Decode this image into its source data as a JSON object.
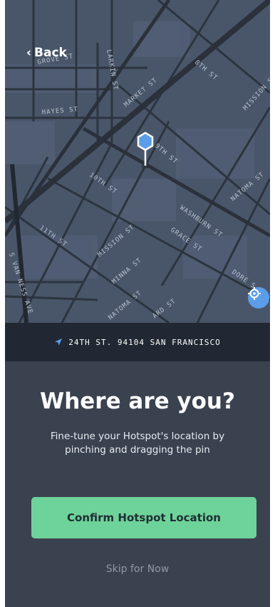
{
  "nav": {
    "back_label": "Back",
    "back_icon": "chevron-left-icon"
  },
  "map": {
    "streets": {
      "grove": "GROVE ST",
      "larkin": "LARKIN ST",
      "eighth": "8TH ST",
      "market": "MARKET ST",
      "mission_top": "MISSION S",
      "hayes": "HAYES ST",
      "ninth": "9TH ST",
      "tenth": "10TH ST",
      "natoma_right": "NATOMA ST",
      "washburn": "WASHBURN ST",
      "eleventh": "11TH ST",
      "mission_mid": "MISSION ST",
      "grace": "GRACE ST",
      "van_ness": "S VAN NESS AVE",
      "minna": "MINNA ST",
      "dore": "DORE S",
      "natoma_bottom": "NATOMA ST",
      "howard": "ARD ST"
    },
    "pin_icon": "map-pin-icon",
    "locate_icon": "crosshair-icon",
    "colors": {
      "map_bg": "#49566a",
      "road": "#2c343f",
      "block": "#566377"
    }
  },
  "address": {
    "icon": "navigation-arrow-icon",
    "text": "24TH ST. 94104 SAN FRANCISCO"
  },
  "main": {
    "heading": "Where are you?",
    "subtitle": "Fine-tune your Hotspot's location by pinching and dragging the pin",
    "confirm_label": "Confirm Hotspot Location",
    "skip_label": "Skip for Now"
  },
  "colors": {
    "accent": "#6ed39a",
    "pin": "#5b9de8",
    "background": "#3a4250"
  }
}
